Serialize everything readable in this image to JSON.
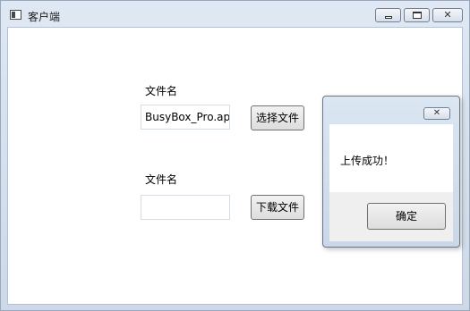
{
  "window": {
    "title": "客户端",
    "icon": "app-window-icon",
    "controls": {
      "minimize": "minimize-icon",
      "maximize": "maximize-icon",
      "close": "close-icon"
    }
  },
  "upload": {
    "label": "文件名",
    "filename_value": "BusyBox_Pro.apk",
    "button_label": "选择文件"
  },
  "download": {
    "label": "文件名",
    "filename_value": "",
    "button_label": "下载文件"
  },
  "dialog": {
    "message": "上传成功！",
    "ok_label": "确定",
    "close_glyph": "✕"
  }
}
